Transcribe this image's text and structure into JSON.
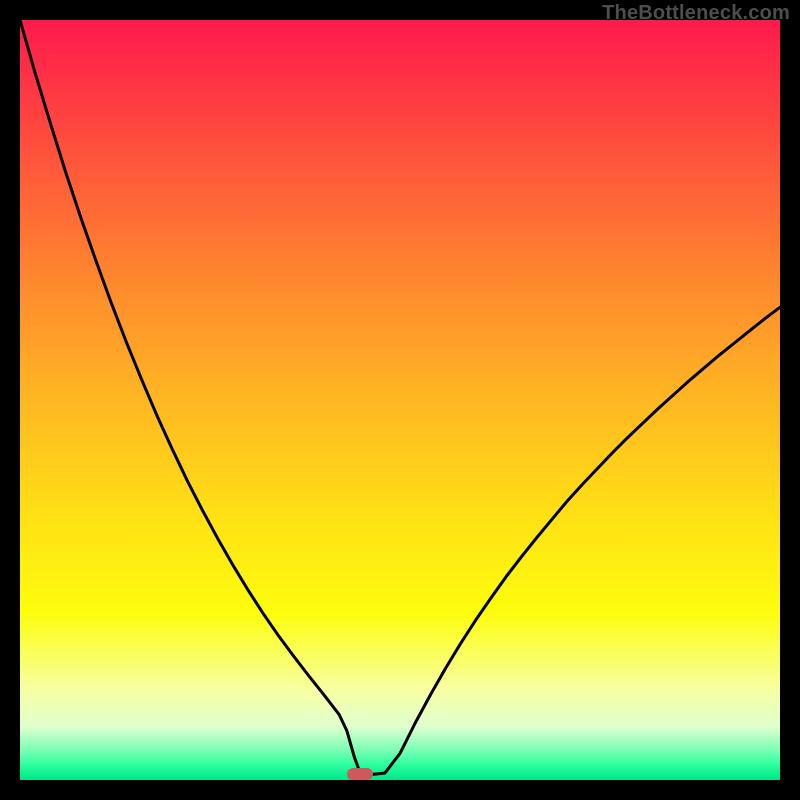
{
  "watermark": "TheBottleneck.com",
  "colors": {
    "marker": "#cc5a5a",
    "curve_stroke": "#000000",
    "frame_bg": "#000000"
  },
  "chart_data": {
    "type": "line",
    "title": "",
    "xlabel": "",
    "ylabel": "",
    "xlim": [
      0,
      100
    ],
    "ylim": [
      0,
      100
    ],
    "x": [
      0,
      2,
      4,
      6,
      8,
      10,
      12,
      14,
      16,
      18,
      20,
      22,
      24,
      26,
      28,
      30,
      32,
      34,
      36,
      38,
      40,
      41,
      42,
      43,
      44,
      44.8,
      46,
      48,
      50,
      52,
      54,
      56,
      58,
      60,
      62,
      64,
      66,
      68,
      70,
      72,
      74,
      76,
      78,
      80,
      82,
      84,
      86,
      88,
      90,
      92,
      94,
      96,
      98,
      100
    ],
    "values": [
      100,
      93,
      86.4,
      80,
      74,
      68.3,
      62.8,
      57.6,
      52.7,
      48,
      43.6,
      39.4,
      35.5,
      31.8,
      28.3,
      25,
      21.9,
      19,
      16.3,
      13.7,
      11.2,
      9.9,
      8.6,
      6.5,
      3.0,
      0.8,
      0.7,
      0.9,
      3.5,
      7.5,
      11.2,
      14.7,
      18.0,
      21.1,
      24.0,
      26.8,
      29.4,
      31.9,
      34.3,
      36.7,
      38.9,
      41.0,
      43.1,
      45.1,
      47,
      48.9,
      50.7,
      52.5,
      54.2,
      55.9,
      57.5,
      59.1,
      60.7,
      62.2
    ],
    "marker": {
      "x": 44.8,
      "y": 0.8
    },
    "grid": false,
    "legend": false
  }
}
